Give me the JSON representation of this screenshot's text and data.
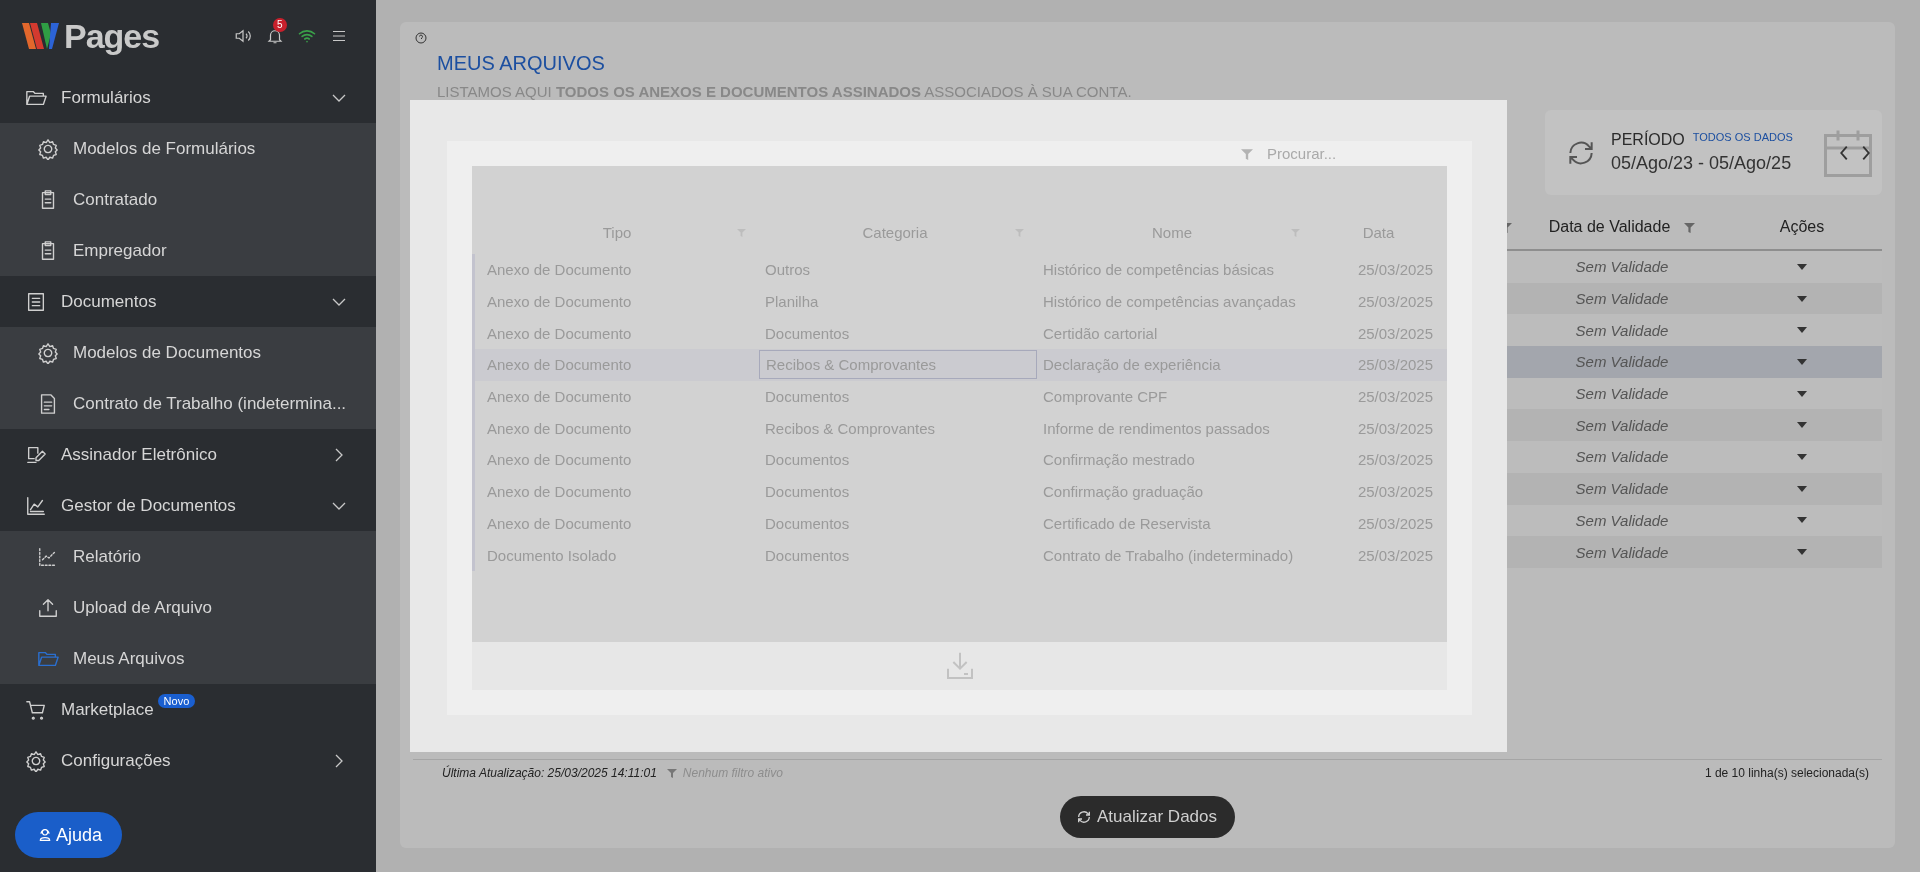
{
  "sidebar": {
    "logo": {
      "text": "Pages"
    },
    "notification_count": "5",
    "nav": [
      {
        "label": "Formulários",
        "kind": "group",
        "expanded": true,
        "children": [
          {
            "label": "Modelos de Formulários",
            "selected": false
          },
          {
            "label": "Contratado",
            "selected": false
          },
          {
            "label": "Empregador",
            "selected": false
          }
        ]
      },
      {
        "label": "Documentos",
        "kind": "group",
        "expanded": true,
        "children": [
          {
            "label": "Modelos de Documentos",
            "selected": false
          },
          {
            "label": "Contrato de Trabalho (indetermina...",
            "selected": false
          }
        ]
      },
      {
        "label": "Assinador Eletrônico",
        "kind": "group",
        "expanded": false
      },
      {
        "label": "Gestor de Documentos",
        "kind": "group",
        "expanded": true,
        "children": [
          {
            "label": "Relatório",
            "selected": false
          },
          {
            "label": "Upload de Arquivo",
            "selected": false
          },
          {
            "label": "Meus Arquivos",
            "selected": true
          }
        ]
      },
      {
        "label": "Marketplace",
        "kind": "link",
        "badge": "Novo"
      },
      {
        "label": "Configurações",
        "kind": "group",
        "expanded": false
      }
    ],
    "help_button": "Ajuda"
  },
  "page": {
    "title": "MEUS ARQUIVOS",
    "subtitle": "LISTAMOS AQUI **TODOS OS ANEXOS E DOCUMENTOS ASSINADOS** ASSOCIADOS À SUA CONTA.",
    "period": {
      "label": "PERÍODO",
      "range_link": "TODOS OS DADOS",
      "dates": "05/Ago/23 - 05/Ago/25"
    },
    "table": {
      "columns": [
        {
          "filter": true
        },
        {
          "label": "Data de Validade",
          "filter": true
        },
        {
          "label": "Ações",
          "filter": false
        }
      ],
      "rows": [
        {
          "validade": "Sem Validade",
          "selected": false
        },
        {
          "validade": "Sem Validade",
          "selected": false
        },
        {
          "validade": "Sem Validade",
          "selected": false
        },
        {
          "validade": "Sem Validade",
          "selected": true
        },
        {
          "validade": "Sem Validade",
          "selected": false
        },
        {
          "validade": "Sem Validade",
          "selected": false
        },
        {
          "validade": "Sem Validade",
          "selected": false
        },
        {
          "validade": "Sem Validade",
          "selected": false
        },
        {
          "validade": "Sem Validade",
          "selected": false
        },
        {
          "validade": "Sem Validade",
          "selected": false
        }
      ]
    },
    "footer": {
      "last_update": "Última Atualização: 25/03/2025 14:11:01",
      "filter_status": "Nenhum filtro ativo",
      "selection_count": "1 de 10 linha(s) selecionada(s)"
    },
    "refresh_button": "Atualizar Dados"
  },
  "drag_preview": {
    "search": {
      "placeholder": "Procurar..."
    },
    "columns": [
      {
        "label": "Tipo",
        "filter": true
      },
      {
        "label": "Categoria",
        "filter": true
      },
      {
        "label": "Nome",
        "filter": true
      },
      {
        "label": "Data",
        "filter": false
      }
    ],
    "rows": [
      {
        "tipo": "Anexo de Documento",
        "categoria": "Outros",
        "nome": "Histórico de competências básicas",
        "data": "25/03/2025",
        "selected": false
      },
      {
        "tipo": "Anexo de Documento",
        "categoria": "Planilha",
        "nome": "Histórico de competências avançadas",
        "data": "25/03/2025",
        "selected": false
      },
      {
        "tipo": "Anexo de Documento",
        "categoria": "Documentos",
        "nome": "Certidão cartorial",
        "data": "25/03/2025",
        "selected": false
      },
      {
        "tipo": "Anexo de Documento",
        "categoria": "Recibos & Comprovantes",
        "nome": "Declaração de experiência",
        "data": "25/03/2025",
        "selected": true
      },
      {
        "tipo": "Anexo de Documento",
        "categoria": "Documentos",
        "nome": "Comprovante CPF",
        "data": "25/03/2025",
        "selected": false
      },
      {
        "tipo": "Anexo de Documento",
        "categoria": "Recibos & Comprovantes",
        "nome": "Informe de rendimentos passados",
        "data": "25/03/2025",
        "selected": false
      },
      {
        "tipo": "Anexo de Documento",
        "categoria": "Documentos",
        "nome": "Confirmação mestrado",
        "data": "25/03/2025",
        "selected": false
      },
      {
        "tipo": "Anexo de Documento",
        "categoria": "Documentos",
        "nome": "Confirmação graduação",
        "data": "25/03/2025",
        "selected": false
      },
      {
        "tipo": "Anexo de Documento",
        "categoria": "Documentos",
        "nome": "Certificado de Reservista",
        "data": "25/03/2025",
        "selected": false
      },
      {
        "tipo": "Documento Isolado",
        "categoria": "Documentos",
        "nome": "Contrato de Trabalho (indeterminado)",
        "data": "25/03/2025",
        "selected": false
      }
    ]
  }
}
